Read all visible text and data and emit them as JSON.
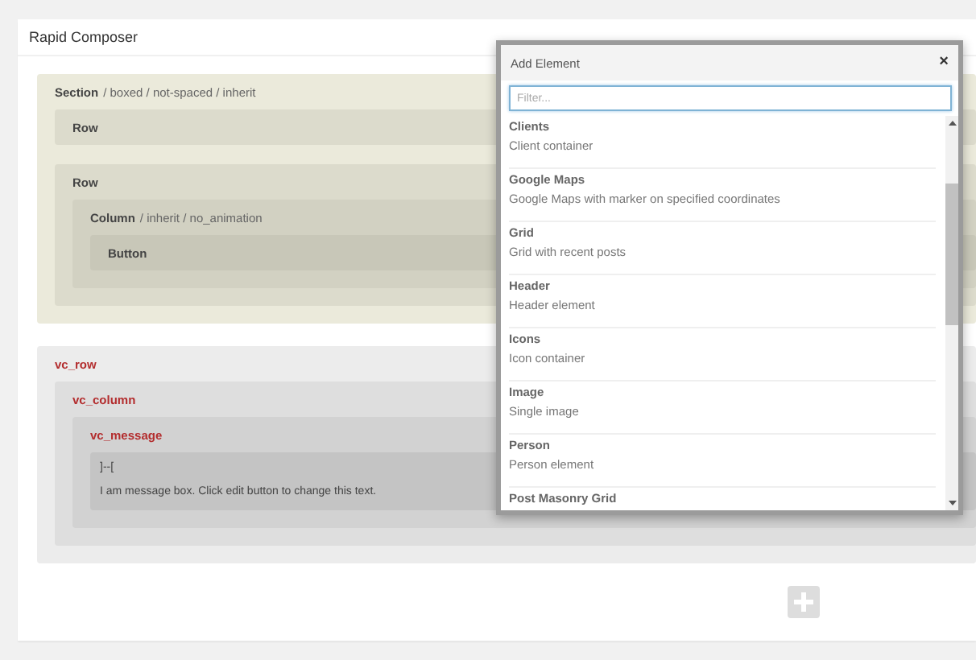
{
  "composer": {
    "title": "Rapid Composer",
    "blocks": [
      {
        "kind": "native",
        "label": "Section",
        "meta": "/ boxed / not-spaced / inherit",
        "children": [
          {
            "kind": "native",
            "label": "Row"
          },
          {
            "kind": "native",
            "label": "Row",
            "children": [
              {
                "kind": "native",
                "label": "Column",
                "meta": "/ inherit / no_animation",
                "children": [
                  {
                    "kind": "native",
                    "label": "Button"
                  }
                ]
              }
            ]
          }
        ]
      },
      {
        "kind": "shortcode",
        "label": "vc_row",
        "children": [
          {
            "kind": "shortcode",
            "label": "vc_column",
            "children": [
              {
                "kind": "shortcode",
                "label": "vc_message",
                "content": [
                  "]--[",
                  "I am message box. Click edit button to change this text."
                ]
              }
            ]
          }
        ]
      }
    ]
  },
  "dialog": {
    "title": "Add Element",
    "close": "×",
    "filter": {
      "placeholder": "Filter..."
    },
    "items": [
      {
        "name": "Clients",
        "description": "Client container"
      },
      {
        "name": "Google Maps",
        "description": "Google Maps with marker on specified coordinates"
      },
      {
        "name": "Grid",
        "description": "Grid with recent posts"
      },
      {
        "name": "Header",
        "description": "Header element"
      },
      {
        "name": "Icons",
        "description": "Icon container"
      },
      {
        "name": "Image",
        "description": "Single image"
      },
      {
        "name": "Person",
        "description": "Person element"
      },
      {
        "name": "Post Masonry Grid"
      }
    ]
  }
}
